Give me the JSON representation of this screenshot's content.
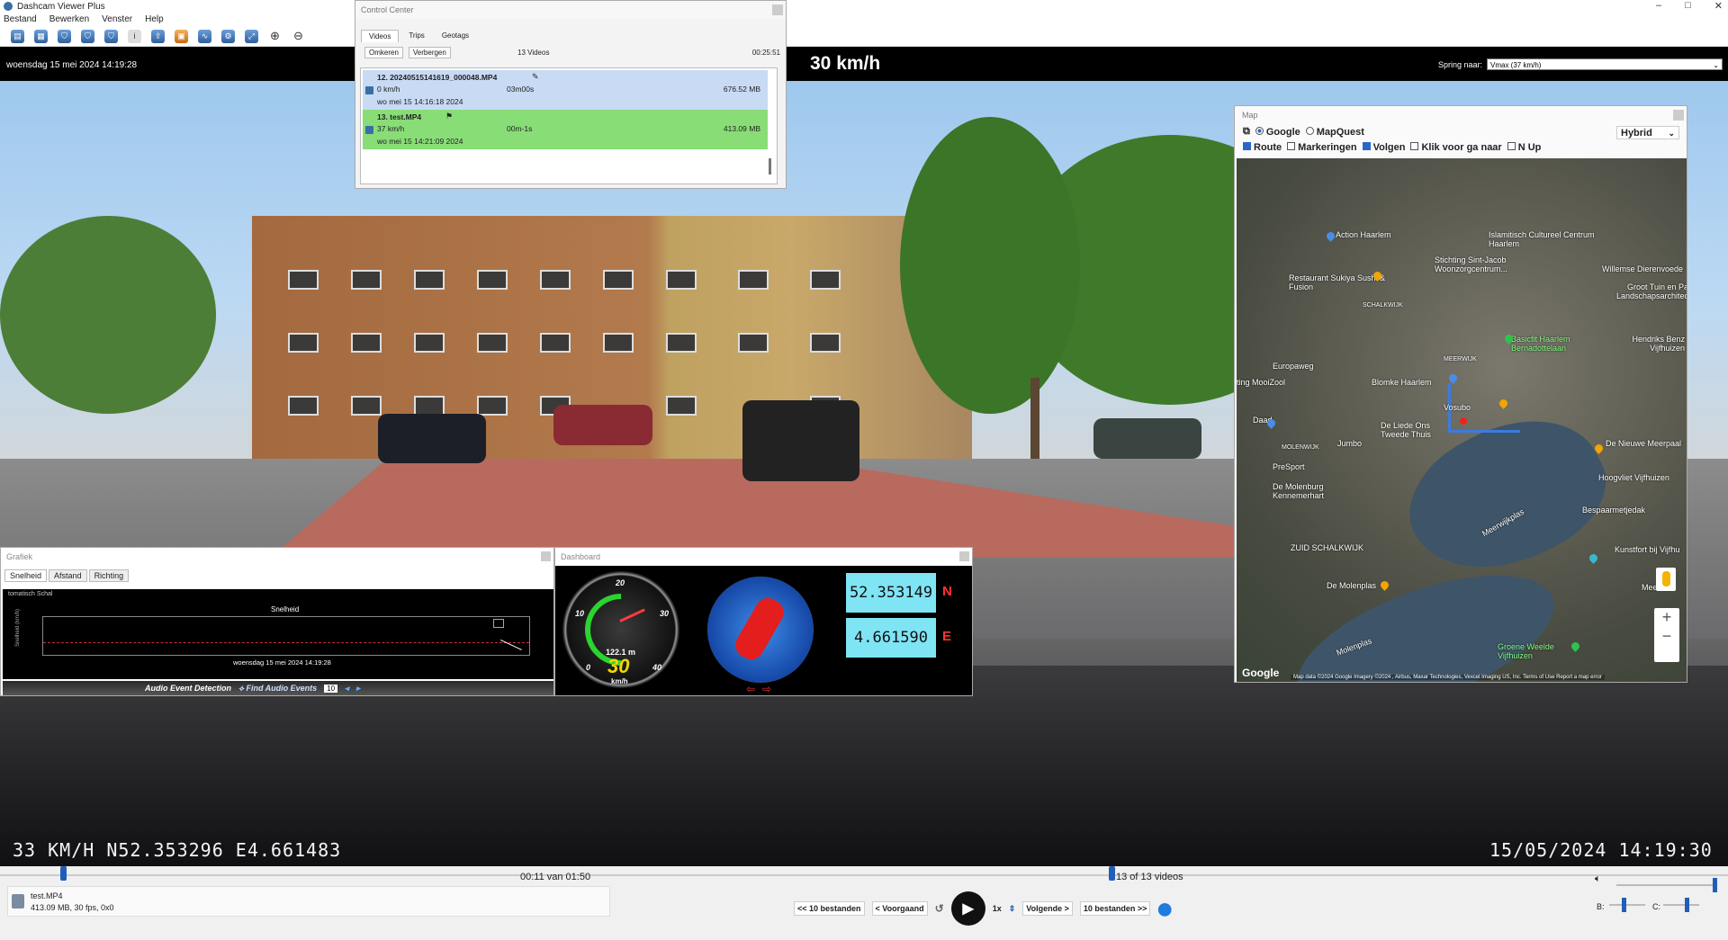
{
  "app": {
    "title": "Dashcam Viewer Plus"
  },
  "menu": [
    "Bestand",
    "Bewerken",
    "Venster",
    "Help"
  ],
  "toolbar_icons": [
    "open-file-icon",
    "open-folder-icon",
    "shield-icon",
    "shield-lock-icon",
    "shield-alt-icon",
    "info-icon",
    "export-icon",
    "camera-icon",
    "audio-wave-icon",
    "settings-gear-icon",
    "expand-icon",
    "zoom-in-icon",
    "zoom-out-icon"
  ],
  "info": {
    "date": "woensdag 15 mei 2024 14:19:28",
    "speed": "30 km/h",
    "jump_label": "Spring naar:",
    "jump_value": "Vmax (37 km/h)"
  },
  "control_center": {
    "title": "Control Center",
    "tabs": [
      "Videos",
      "Trips",
      "Geotags"
    ],
    "buttons": [
      "Omkeren",
      "Verbergen"
    ],
    "count": "13 Videos",
    "duration": "00:25:51",
    "rows": [
      {
        "name": "12. 20240515141619_000048.MP4",
        "speed": "0 km/h",
        "dur": "03m00s",
        "size": "676.52 MB",
        "date": "wo mei 15 14:16:18 2024",
        "color": "#c8daf4"
      },
      {
        "name": "13. test.MP4",
        "speed": "37 km/h",
        "dur": "00m-1s",
        "size": "413.09 MB",
        "date": "wo mei 15 14:21:09 2024",
        "color": "#88dd77"
      }
    ]
  },
  "map": {
    "title": "Map",
    "providers": [
      "Google",
      "MapQuest"
    ],
    "options": [
      "Route",
      "Markeringen",
      "Volgen",
      "Klik voor ga naar",
      "N Up"
    ],
    "options_checked": [
      true,
      false,
      true,
      false,
      false
    ],
    "map_type": "Hybrid",
    "labels": [
      "Action Haarlem",
      "Islamitisch Cultureel Centrum Haarlem",
      "Stichting Sint-Jacob Woonzorgcentrum...",
      "Restaurant Sukiya Sushi & Fusion",
      "Willemse Dierenvoede",
      "Groot Tuin en Pa Landschapsarchitec",
      "SCHALKWIJK",
      "Europaweg",
      "Basicfit Haarlem Bernadottelaan",
      "Hendriks Benz Vijfhuizen",
      "ting MooiZool",
      "Blomke Haarlem",
      "MEERWIJK",
      "Vosubo",
      "Daad",
      "De Liede Ons Tweede Thuis",
      "De Nieuwe Meerpaal",
      "MOLENWIJK",
      "Jumbo",
      "PreSport",
      "Hoogvliet Vijfhuizen",
      "De Molenburg Kennemerhart",
      "Meerwijkplas",
      "Bespaarmetjedak",
      "ZUID SCHALKWIJK",
      "Kunstfort bij Vijfhu",
      "De Molenplas",
      "Meester",
      "Molenplas",
      "Groene Weelde Vijfhuizen",
      "Google"
    ],
    "attribution": "Map data ©2024 Google Imagery ©2024 , Airbus, Maxar Technologies, Vexcel Imaging US, Inc.   Terms of Use   Report a map error"
  },
  "graph": {
    "title": "Grafiek",
    "tabs": [
      "Snelheid",
      "Afstand",
      "Richting"
    ],
    "caption": "tomatisch Schal",
    "plot_title": "Snelheid",
    "ylabel": "Snelheid (km/h)",
    "xdate": "woensdag 15 mei 2024 14:19:28",
    "audio_label": "Audio Event Detection",
    "find_label": "Find Audio Events",
    "audio_value": "10"
  },
  "dashboard": {
    "title": "Dashboard",
    "gauge_ticks": [
      "0",
      "10",
      "20",
      "30",
      "40"
    ],
    "distance": "122.1 m",
    "speed": "30",
    "unit": "km/h",
    "lat": "52.353149",
    "lat_dir": "N",
    "lon": "4.661590",
    "lon_dir": "E"
  },
  "video": {
    "overlay_left": "33 KM/H N52.353296 E4.661483",
    "overlay_right": "15/05/2024 14:19:30"
  },
  "timeline": {
    "time": "00:11 van 01:50",
    "videos": "13 of 13 videos",
    "progress": 0.1,
    "file_name": "test.MP4",
    "file_info": "413.09 MB, 30 fps, 0x0",
    "prev10": "<< 10 bestanden",
    "prev": "< Voorgaand",
    "rate": "1x",
    "next": "Volgende >",
    "next10": "10 bestanden >>",
    "b_label": "B:",
    "c_label": "C:"
  }
}
